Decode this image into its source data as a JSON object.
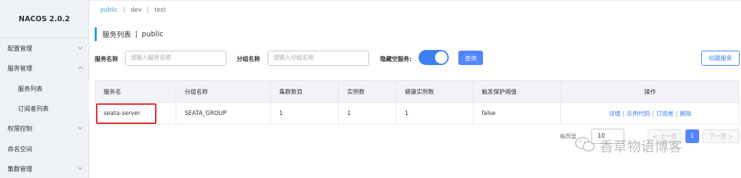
{
  "app": {
    "brand": "NACOS 2.0.2"
  },
  "sidebar": {
    "items": [
      {
        "label": "配置管理"
      },
      {
        "label": "服务管理"
      },
      {
        "label": "服务列表"
      },
      {
        "label": "订阅者列表"
      },
      {
        "label": "权限控制"
      },
      {
        "label": "命名空间"
      },
      {
        "label": "集群管理"
      }
    ]
  },
  "env_tabs": [
    {
      "label": "public"
    },
    {
      "label": "dev"
    },
    {
      "label": "test"
    }
  ],
  "env_sep": "|",
  "page": {
    "title": "服务列表",
    "sep": "|",
    "namespace": "public"
  },
  "filters": {
    "service_label": "服务名称",
    "service_placeholder": "请输入服务名称",
    "group_label": "分组名称",
    "group_placeholder": "请输入分组名称",
    "hide_empty_label": "隐藏空服务:",
    "hide_empty_on": true,
    "query_label": "查询",
    "create_label": "创建服务"
  },
  "table": {
    "headers": [
      "服务名",
      "分组名称",
      "集群数目",
      "实例数",
      "健康实例数",
      "触发保护阈值",
      "操作"
    ],
    "rows": [
      {
        "service": "seata-server",
        "group": "SEATA_GROUP",
        "clusters": "1",
        "instances": "1",
        "healthy": "1",
        "protect": "false",
        "ops": [
          "详情",
          "示例代码",
          "订阅者",
          "删除"
        ]
      }
    ],
    "op_sep": "|"
  },
  "pagination": {
    "per_page_label": "每页显",
    "page_size": "10",
    "prev_label": "< 上一页",
    "current_page": "1",
    "next_label": "下一页 >"
  },
  "watermark": {
    "text": "香草物语博客"
  },
  "colors": {
    "accent": "#3e7ef5",
    "primary_button": "#5584ff",
    "highlight": "#e02020",
    "env_active": "#1e9fd8"
  }
}
